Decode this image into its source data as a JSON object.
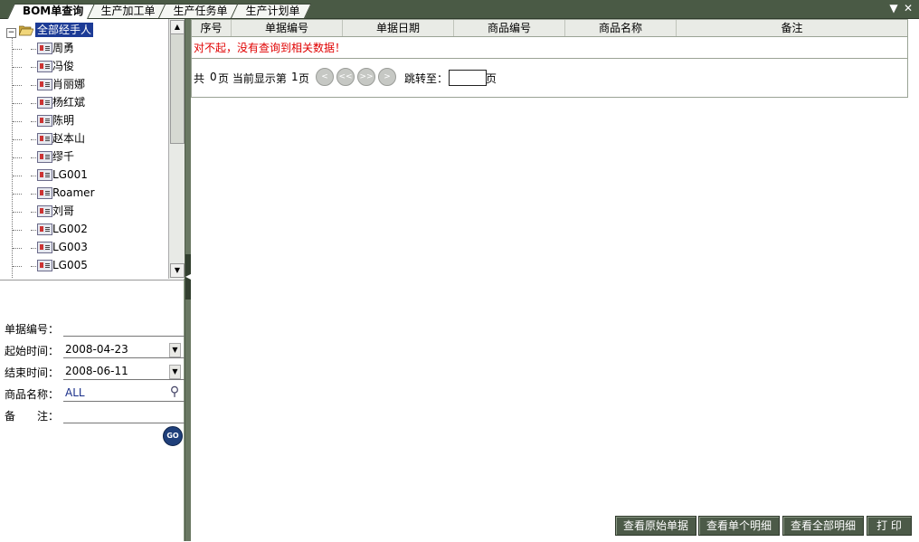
{
  "tabs": [
    {
      "label": "BOM单查询",
      "active": true
    },
    {
      "label": "生产加工单",
      "active": false
    },
    {
      "label": "生产任务单",
      "active": false
    },
    {
      "label": "生产计划单",
      "active": false
    }
  ],
  "tab_controls": {
    "menu": "▼",
    "close": "✕"
  },
  "tree": {
    "root": "全部经手人",
    "items": [
      "周勇",
      "冯俊",
      "肖丽娜",
      "杨红斌",
      "陈明",
      "赵本山",
      "缪千",
      "LG001",
      "Roamer",
      "刘哥",
      "LG002",
      "LG003",
      "LG005"
    ]
  },
  "form": {
    "doc_no_label": "单据编号：",
    "doc_no_value": "",
    "start_label": "起始时间：",
    "start_value": "2008-04-23",
    "end_label": "结束时间：",
    "end_value": "2008-06-11",
    "product_label": "商品名称：",
    "product_value": "ALL",
    "remark_label": "备　　注：",
    "remark_value": "",
    "go_label": "GO"
  },
  "grid": {
    "columns": [
      "序号",
      "单据编号",
      "单据日期",
      "商品编号",
      "商品名称",
      "备注"
    ],
    "no_data_message": "对不起，没有查询到相关数据！"
  },
  "pager": {
    "prefix": "共",
    "total_pages": "0",
    "pages_unit": "页 当前显示第",
    "current_page": "1",
    "current_unit": "页",
    "jump_label": "跳转至：",
    "jump_unit": "页",
    "jump_value": ""
  },
  "buttons": {
    "view_original": "查看原始单据",
    "view_single": "查看单个明细",
    "view_all": "查看全部明细",
    "print": "打 印"
  }
}
